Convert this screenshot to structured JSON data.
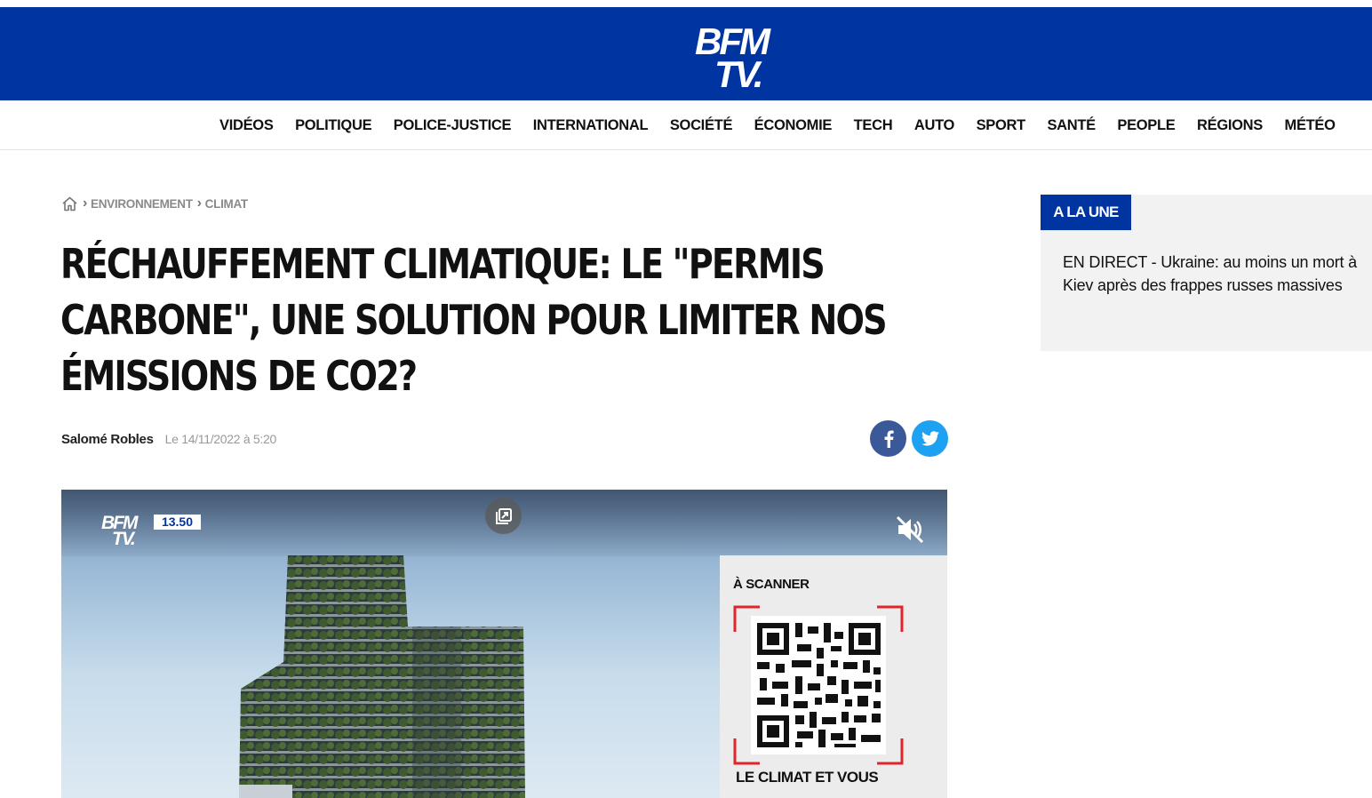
{
  "header": {
    "logo_line1": "BFM",
    "logo_line2": "TV."
  },
  "nav": {
    "items": [
      "VIDÉOS",
      "POLITIQUE",
      "POLICE-JUSTICE",
      "INTERNATIONAL",
      "SOCIÉTÉ",
      "ÉCONOMIE",
      "TECH",
      "AUTO",
      "SPORT",
      "SANTÉ",
      "PEOPLE",
      "RÉGIONS",
      "MÉTÉO"
    ]
  },
  "breadcrumb": {
    "items": [
      "ENVIRONNEMENT",
      "CLIMAT"
    ]
  },
  "article": {
    "title": "RÉCHAUFFEMENT CLIMATIQUE: LE \"PERMIS CARBONE\", UNE SOLUTION POUR LIMITER NOS ÉMISSIONS DE CO2?",
    "author": "Salomé Robles",
    "date": "Le 14/11/2022 à 5:20"
  },
  "share": {
    "facebook_icon": "facebook-icon",
    "twitter_icon": "twitter-icon"
  },
  "video": {
    "logo_line1": "BFM",
    "logo_line2": "TV.",
    "time": "13.50",
    "scan_title": "À SCANNER",
    "scan_footer": "LE CLIMAT ET VOUS"
  },
  "sidebar": {
    "tag": "A LA UNE",
    "headline": "EN DIRECT - Ukraine: au moins un mort à Kiev après des frappes russes massives"
  },
  "colors": {
    "brand_blue": "#0034a0",
    "facebook": "#3b5998",
    "twitter": "#1da1f2"
  }
}
